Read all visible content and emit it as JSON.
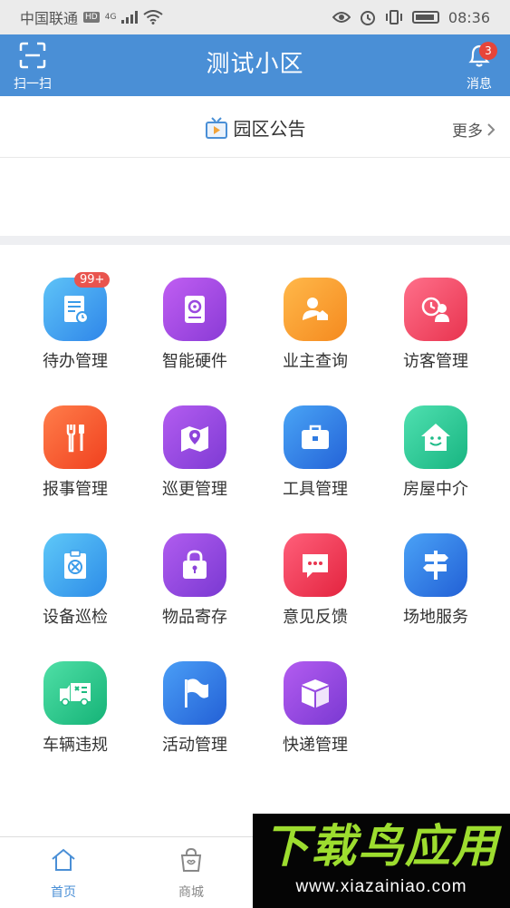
{
  "status_bar": {
    "carrier": "中国联通",
    "hd": "HD",
    "network": "4G",
    "time": "08:36"
  },
  "header": {
    "title": "测试小区",
    "scan_label": "扫一扫",
    "message_label": "消息",
    "message_count": "3"
  },
  "notice": {
    "title": "园区公告",
    "more_label": "更多"
  },
  "grid": {
    "items": [
      {
        "label": "待办管理",
        "icon": "todo-doc-icon",
        "badge": "99+"
      },
      {
        "label": "智能硬件",
        "icon": "hardware-device-icon"
      },
      {
        "label": "业主查询",
        "icon": "owner-search-icon"
      },
      {
        "label": "访客管理",
        "icon": "visitor-clock-icon"
      },
      {
        "label": "报事管理",
        "icon": "repair-tools-icon"
      },
      {
        "label": "巡更管理",
        "icon": "patrol-map-icon"
      },
      {
        "label": "工具管理",
        "icon": "toolbox-icon"
      },
      {
        "label": "房屋中介",
        "icon": "house-smile-icon"
      },
      {
        "label": "设备巡检",
        "icon": "equipment-check-icon"
      },
      {
        "label": "物品寄存",
        "icon": "storage-lock-icon"
      },
      {
        "label": "意见反馈",
        "icon": "feedback-chat-icon"
      },
      {
        "label": "场地服务",
        "icon": "venue-signpost-icon"
      },
      {
        "label": "车辆违规",
        "icon": "vehicle-truck-icon"
      },
      {
        "label": "活动管理",
        "icon": "activity-flag-icon"
      },
      {
        "label": "快递管理",
        "icon": "express-box-icon"
      }
    ]
  },
  "tabbar": {
    "home_label": "首页",
    "mall_label": "商城"
  },
  "watermark": {
    "logo_text": "下载鸟应用",
    "url": "www.xiazainiao.com"
  }
}
